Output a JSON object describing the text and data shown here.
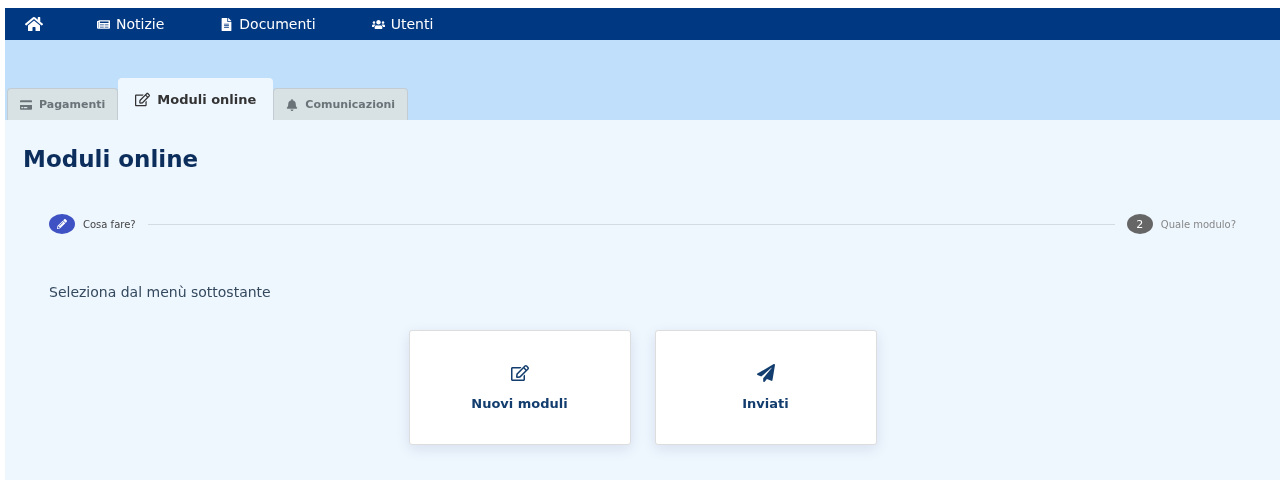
{
  "nav": {
    "items": [
      {
        "label": "Notizie"
      },
      {
        "label": "Documenti"
      },
      {
        "label": "Utenti"
      }
    ]
  },
  "tabs": [
    {
      "label": "Pagamenti",
      "selected": false
    },
    {
      "label": "Moduli online",
      "selected": true
    },
    {
      "label": "Comunicazioni",
      "selected": false
    }
  ],
  "title": "Moduli online",
  "stepper": [
    {
      "label": "Cosa fare?",
      "done": true
    },
    {
      "label": "Quale modulo?",
      "done": false,
      "number": "2"
    }
  ],
  "instruction": "Seleziona dal menù sottostante",
  "cards": [
    {
      "label": "Nuovi moduli"
    },
    {
      "label": "Inviati"
    }
  ]
}
